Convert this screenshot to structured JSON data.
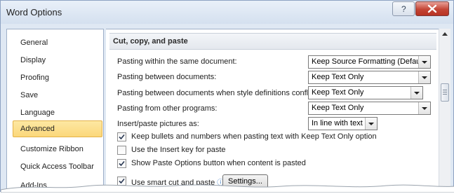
{
  "window": {
    "title": "Word Options",
    "help_glyph": "?",
    "close_glyph": "X"
  },
  "sidebar": {
    "items": [
      {
        "label": "General"
      },
      {
        "label": "Display"
      },
      {
        "label": "Proofing"
      },
      {
        "label": "Save"
      },
      {
        "label": "Language"
      },
      {
        "label": "Advanced",
        "selected": true
      },
      {
        "label": "Customize Ribbon"
      },
      {
        "label": "Quick Access Toolbar"
      },
      {
        "label": "Add-Ins"
      }
    ]
  },
  "section": {
    "title": "Cut, copy, and paste",
    "options": [
      {
        "label": "Pasting within the same document:",
        "value": "Keep Source Formatting (Default)"
      },
      {
        "label": "Pasting between documents:",
        "value": "Keep Text Only"
      },
      {
        "label": "Pasting between documents when style definitions conflict:",
        "value": "Keep Text Only"
      },
      {
        "label": "Pasting from other programs:",
        "value": "Keep Text Only"
      },
      {
        "label": "Insert/paste pictures as:",
        "value": "In line with text"
      }
    ],
    "checkboxes": [
      {
        "label": "Keep bullets and numbers when pasting text with Keep Text Only option",
        "checked": true
      },
      {
        "label": "Use the Insert key for paste",
        "checked": false
      },
      {
        "label": "Show Paste Options button when content is pasted",
        "checked": true
      },
      {
        "label": "Use smart cut and paste",
        "checked": true
      }
    ],
    "info_glyph": "ⓘ",
    "settings_button": "Settings..."
  },
  "colors": {
    "selected_bg": "#fbd77a",
    "close_red": "#c44535",
    "frame": "#dfe8f3"
  }
}
